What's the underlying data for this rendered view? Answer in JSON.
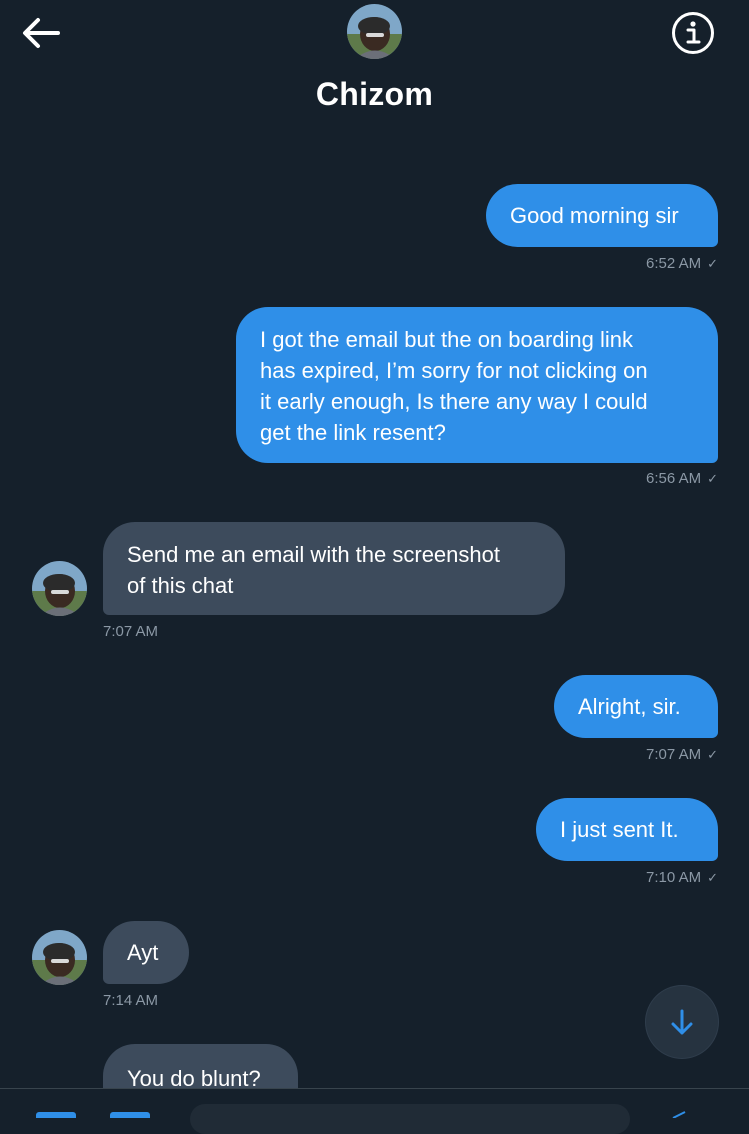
{
  "header": {
    "title": "Chizom",
    "back_icon": "arrow-left-icon",
    "info_icon": "info-circle-icon"
  },
  "messages": [
    {
      "direction": "out",
      "lines": [
        "Good morning sir"
      ],
      "time": "6:52 AM",
      "status": "✓"
    },
    {
      "direction": "out",
      "lines": [
        "I got the email but the on boarding link",
        "has expired, I’m sorry for not clicking on",
        "it early enough, Is there any way I could",
        "get the link resent?"
      ],
      "time": "6:56 AM",
      "status": "✓"
    },
    {
      "direction": "in",
      "lines": [
        "Send me an email with the screenshot",
        "of this chat"
      ],
      "time": "7:07 AM"
    },
    {
      "direction": "out",
      "lines": [
        "Alright, sir."
      ],
      "time": "7:07 AM",
      "status": "✓"
    },
    {
      "direction": "out",
      "lines": [
        "I just sent It."
      ],
      "time": "7:10 AM",
      "status": "✓"
    },
    {
      "direction": "in",
      "lines": [
        "Ayt"
      ],
      "time": "7:14 AM"
    },
    {
      "direction": "in",
      "lines": [
        "You do blunt?"
      ]
    }
  ],
  "scroll_button_icon": "arrow-down-icon",
  "colors": {
    "background": "#15202b",
    "outgoing_bubble": "#2f8fe8",
    "incoming_bubble": "#3d4b5c",
    "timestamp": "#8b98a5"
  }
}
